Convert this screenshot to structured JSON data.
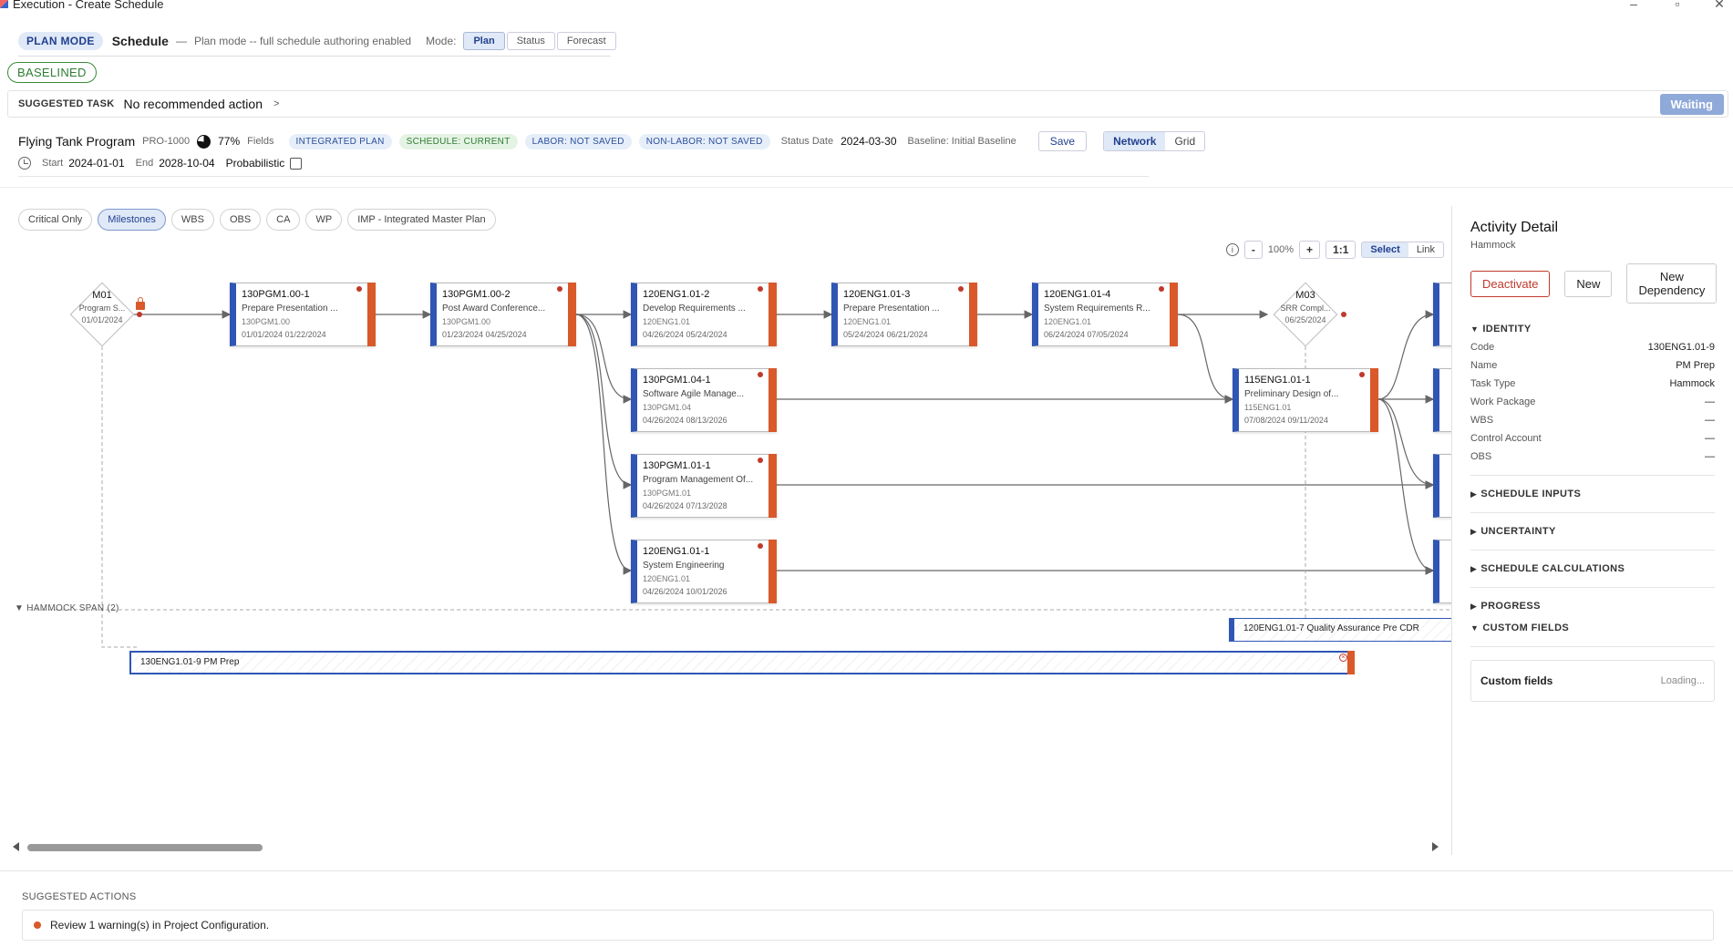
{
  "window": {
    "title": "Execution - Create Schedule"
  },
  "mode_bar": {
    "badge": "PLAN MODE",
    "title": "Schedule",
    "dash": "—",
    "description": "Plan mode -- full schedule authoring enabled",
    "mode_label": "Mode:",
    "modes": [
      "Plan",
      "Status",
      "Forecast"
    ],
    "active_mode": "Plan"
  },
  "baseline_badge": "BASELINED",
  "suggested_task": {
    "label": "SUGGESTED TASK",
    "text": "No recommended action",
    "chevron": ">",
    "status": "Waiting"
  },
  "program": {
    "name": "Flying Tank Program",
    "id": "PRO-1000",
    "fields_pct": "77%",
    "fields_label": "Fields",
    "fields_fraction": 0.77,
    "badges": [
      "INTEGRATED PLAN",
      "SCHEDULE: CURRENT",
      "LABOR: NOT SAVED",
      "NON-LABOR: NOT SAVED"
    ],
    "status_date_label": "Status Date",
    "status_date": "2024-03-30",
    "baseline": "Baseline: Initial Baseline",
    "save": "Save",
    "views": [
      "Network",
      "Grid"
    ],
    "start_label": "Start",
    "start": "2024-01-01",
    "end_label": "End",
    "end": "2028-10-04",
    "probabilistic": "Probabilistic"
  },
  "filters": [
    "Critical Only",
    "Milestones",
    "WBS",
    "OBS",
    "CA",
    "WP",
    "IMP - Integrated Master Plan"
  ],
  "active_filter": "Milestones",
  "graph_toolbar": {
    "minus": "-",
    "zoom": "100%",
    "plus": "+",
    "reset": "1:1",
    "select": "Select",
    "link": "Link"
  },
  "milestones": [
    {
      "code": "M01",
      "name": "Program S...",
      "date": "01/01/2024"
    },
    {
      "code": "M03",
      "name": "SRR Compl...",
      "date": "06/25/2024"
    }
  ],
  "activities": [
    {
      "code": "130PGM1.00-1",
      "name": "Prepare Presentation ...",
      "wp": "130PGM1.00",
      "dates": "01/01/2024  01/22/2024"
    },
    {
      "code": "130PGM1.00-2",
      "name": "Post Award Conference...",
      "wp": "130PGM1.00",
      "dates": "01/23/2024  04/25/2024"
    },
    {
      "code": "120ENG1.01-2",
      "name": "Develop Requirements ...",
      "wp": "120ENG1.01",
      "dates": "04/26/2024  05/24/2024"
    },
    {
      "code": "120ENG1.01-3",
      "name": "Prepare Presentation ...",
      "wp": "120ENG1.01",
      "dates": "05/24/2024  06/21/2024"
    },
    {
      "code": "120ENG1.01-4",
      "name": "System Requirements R...",
      "wp": "120ENG1.01",
      "dates": "06/24/2024  07/05/2024"
    },
    {
      "code": "130PGM1.04-1",
      "name": "Software Agile Manage...",
      "wp": "130PGM1.04",
      "dates": "04/26/2024  08/13/2026"
    },
    {
      "code": "130PGM1.01-1",
      "name": "Program Management Of...",
      "wp": "130PGM1.01",
      "dates": "04/26/2024  07/13/2028"
    },
    {
      "code": "120ENG1.01-1",
      "name": "System Engineering",
      "wp": "120ENG1.01",
      "dates": "04/26/2024  10/01/2026"
    },
    {
      "code": "115ENG1.01-1",
      "name": "Preliminary Design of...",
      "wp": "115ENG1.01",
      "dates": "07/08/2024  09/11/2024"
    }
  ],
  "hammock": {
    "label": "HAMMOCK SPAN (2)",
    "bars": [
      "120ENG1.01-7 Quality Assurance Pre CDR",
      "130ENG1.01-9 PM Prep"
    ]
  },
  "detail": {
    "title": "Activity Detail",
    "subtitle": "Hammock",
    "buttons": {
      "deactivate": "Deactivate",
      "new": "New",
      "new_dependency": "New Dependency"
    },
    "identity_label": "IDENTITY",
    "identity": [
      {
        "k": "Code",
        "v": "130ENG1.01-9"
      },
      {
        "k": "Name",
        "v": "PM Prep"
      },
      {
        "k": "Task Type",
        "v": "Hammock"
      },
      {
        "k": "Work Package",
        "v": "—"
      },
      {
        "k": "WBS",
        "v": "—"
      },
      {
        "k": "Control Account",
        "v": "—"
      },
      {
        "k": "OBS",
        "v": "—"
      }
    ],
    "sections": [
      "SCHEDULE INPUTS",
      "UNCERTAINTY",
      "SCHEDULE CALCULATIONS",
      "PROGRESS"
    ],
    "custom_label": "CUSTOM FIELDS",
    "custom_fields": {
      "k": "Custom fields",
      "v": "Loading..."
    }
  },
  "suggested_actions": {
    "label": "SUGGESTED ACTIONS",
    "items": [
      "Review 1 warning(s) in Project Configuration."
    ]
  },
  "colors": {
    "accent": "#2f56b5",
    "orange": "#d9592a",
    "red": "#c0392b",
    "green": "#2e7d32"
  }
}
